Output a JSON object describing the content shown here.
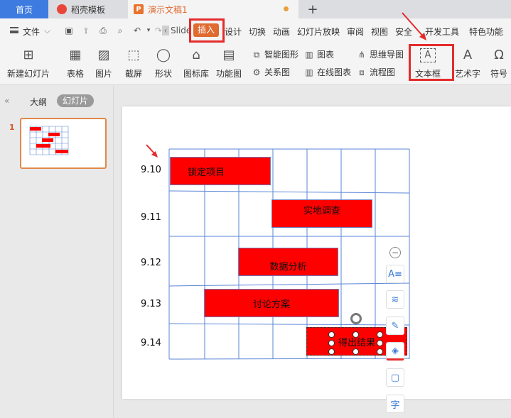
{
  "tabs": {
    "home": "首页",
    "template": "稻壳模板",
    "document": "演示文稿1"
  },
  "menu": {
    "file": "文件",
    "slide_partial": "Slide",
    "insert": "插入",
    "design": "设计",
    "transition": "切换",
    "animation": "动画",
    "slideshow": "幻灯片放映",
    "review": "审阅",
    "view": "视图",
    "security": "安全",
    "devtools": "开发工具",
    "features": "特色功能"
  },
  "ribbon": {
    "new_slide": "新建幻灯片",
    "table": "表格",
    "picture": "图片",
    "screenshot": "截屏",
    "shape": "形状",
    "icon_lib": "图标库",
    "func_chart": "功能图",
    "smart_art": "智能图形",
    "chart": "图表",
    "relation": "关系图",
    "online_chart": "在线图表",
    "mindmap": "思维导图",
    "flowchart": "流程图",
    "textbox": "文本框",
    "wordart": "艺术字",
    "symbol": "符号"
  },
  "panel": {
    "outline": "大纲",
    "slides": "幻灯片",
    "slide_number": "1"
  },
  "slide": {
    "rows": [
      {
        "date": "9.10",
        "task": "锁定项目"
      },
      {
        "date": "9.11",
        "task": "实地调查"
      },
      {
        "date": "9.12",
        "task": "数据分析"
      },
      {
        "date": "9.13",
        "task": "讨论方案"
      },
      {
        "date": "9.14",
        "task": "得出结果"
      }
    ]
  },
  "colors": {
    "accent_orange": "#e06a2f",
    "highlight_red": "#e52b2b",
    "bar_red": "#ff0000",
    "grid_blue": "#5b86d6",
    "home_tab_blue": "#3d7be0"
  },
  "float_tools": [
    "text-style-icon",
    "layers-icon",
    "pen-icon",
    "fill-icon",
    "border-icon",
    "font-icon"
  ]
}
